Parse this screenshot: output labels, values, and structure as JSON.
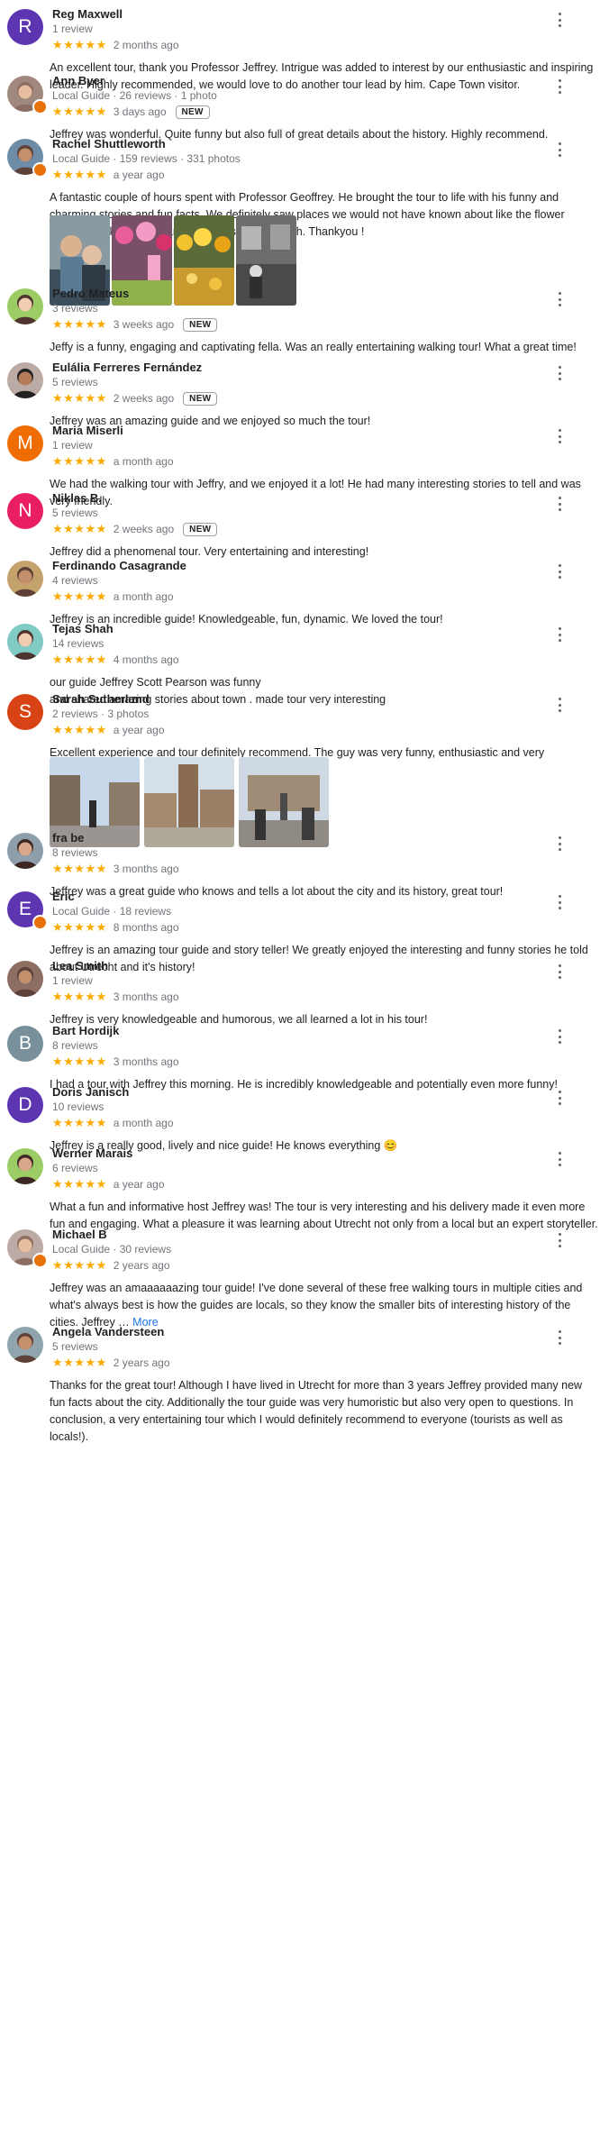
{
  "labels": {
    "new_badge": "NEW",
    "more_link": "More"
  },
  "stars_glyphs": "★★★★★",
  "colors": {
    "star": "#f9ab00",
    "new_border": "#9aa0a6",
    "local_guide_badge": "#e8710a",
    "more_link": "#1a73e8"
  },
  "reviews": [
    {
      "name": "Reg Maxwell",
      "meta": "1 review",
      "rating": 5,
      "date": "2 months ago",
      "text": "An excellent tour, thank you Professor Jeffrey. Intrigue was added to interest by our enthusiastic and inspiring leader. Highly recommended, we would love to do another tour lead by him.  Cape Town visitor.",
      "avatar_letter": "R",
      "avatar_color": "#5e35b1"
    },
    {
      "name": "Ann Byer",
      "meta": "Local Guide · 26 reviews · 1 photo",
      "rating": 5,
      "date": "3 days ago",
      "badge": "NEW",
      "text": "Jeffrey was wonderful. Quite funny but also full of great details about the history. Highly recommend.",
      "avatar_icon": "profile-photo-icon"
    },
    {
      "name": "Rachel Shuttleworth",
      "meta": "Local Guide · 159 reviews · 331 photos",
      "rating": 5,
      "date": "a year ago",
      "text": "A fantastic couple of hours spent with Professor Geoffrey.  He brought the tour to life with his funny and charming stories and fun facts. We definitely saw places we would not have known about like the flower market.  His knowledge and passion shone through. Thankyou !",
      "avatar_icon": "profile-photo-icon"
    },
    {
      "name": "Pedro Mateus",
      "meta": "3 reviews",
      "rating": 5,
      "date": "3 weeks ago",
      "badge": "NEW",
      "text": "Jeffy is a funny, engaging and captivating fella. Was an really entertaining walking tour! What a great time!",
      "avatar_icon": "profile-photo-icon"
    },
    {
      "name": "Eulália Ferreres Fernández",
      "meta": "5 reviews",
      "rating": 5,
      "date": "2 weeks ago",
      "badge": "NEW",
      "text": "Jeffrey was an amazing guide and we enjoyed so much the tour!",
      "avatar_icon": "profile-photo-icon"
    },
    {
      "name": "Maria Miserli",
      "meta": "1 review",
      "rating": 5,
      "date": "a month ago",
      "text": "We had the walking tour with Jeffry, and we enjoyed it a lot! He had many interesting stories to tell and was very friendly.",
      "avatar_letter": "M",
      "avatar_color": "#ef6c00"
    },
    {
      "name": "Niklas B.",
      "meta": "5 reviews",
      "rating": 5,
      "date": "2 weeks ago",
      "badge": "NEW",
      "text": "Jeffrey did a phenomenal tour. Very entertaining and interesting!",
      "avatar_letter": "N",
      "avatar_color": "#e91e63"
    },
    {
      "name": "Ferdinando Casagrande",
      "meta": "4 reviews",
      "rating": 5,
      "date": "a month ago",
      "text": "Jeffrey is an incredible guide! Knowledgeable, fun, dynamic. We loved the tour!",
      "avatar_icon": "profile-photo-icon"
    },
    {
      "name": "Tejas Shah",
      "meta": "14 reviews",
      "rating": 5,
      "date": "4 months ago",
      "text": "our guide Jeffrey Scott Pearson was funny\nand  shared amazing  stories about town . made tour very interesting",
      "avatar_icon": "profile-photo-icon"
    },
    {
      "name": "Sarah Sutherland",
      "meta": "2 reviews · 3 photos",
      "rating": 5,
      "date": "a year ago",
      "text": "Excellent experience and tour definitely recommend. The guy was very funny, enthusiastic and very knowledgable.",
      "avatar_letter": "S",
      "avatar_color": "#d84315"
    },
    {
      "name": "fra be",
      "meta": "8 reviews",
      "rating": 5,
      "date": "3 months ago",
      "text": "Jeffrey was a great guide who knows and tells a lot about the city and its history, great tour!",
      "avatar_icon": "profile-photo-icon"
    },
    {
      "name": "Eric",
      "meta": "Local Guide · 18 reviews",
      "rating": 5,
      "date": "8 months ago",
      "text": "Jeffrey is an amazing tour guide and story teller! We greatly enjoyed the interesting and funny stories he told about Utrecht and it's history!",
      "avatar_letter": "E",
      "avatar_color": "#5e35b1"
    },
    {
      "name": "Lea Smith",
      "meta": "1 review",
      "rating": 5,
      "date": "3 months ago",
      "text": "Jeffrey is very knowledgeable and humorous, we all learned a lot in his tour!",
      "avatar_icon": "profile-photo-icon"
    },
    {
      "name": "Bart Hordijk",
      "meta": "8 reviews",
      "rating": 5,
      "date": "3 months ago",
      "text": "I had a tour with Jeffrey this morning. He is incredibly knowledgeable and potentially even more funny!",
      "avatar_letter": "B",
      "avatar_color": "#78909c"
    },
    {
      "name": "Doris Janisch",
      "meta": "10 reviews",
      "rating": 5,
      "date": "a month ago",
      "text": "Jeffrey is a really good, lively and nice guide! He knows everything 😊",
      "avatar_letter": "D",
      "avatar_color": "#5e35b1"
    },
    {
      "name": "Werner Marais",
      "meta": "6 reviews",
      "rating": 5,
      "date": "a year ago",
      "text": "What a fun and informative host Jeffrey was! The tour is very interesting and his delivery made it even more fun and engaging. What a pleasure it was learning about Utrecht not only from a local but an expert storyteller.",
      "avatar_icon": "profile-photo-icon"
    },
    {
      "name": "Michael B",
      "meta": "Local Guide · 30 reviews",
      "rating": 5,
      "date": "2 years ago",
      "text": "Jeffrey was an amaaaaaazing tour guide! I've done several of these free walking tours in multiple cities and what's always best is how the guides are locals, so they know the smaller bits of interesting history of the cities. Jeffrey … ",
      "more": true,
      "avatar_icon": "profile-photo-icon"
    },
    {
      "name": "Angela Vandersteen",
      "meta": "5 reviews",
      "rating": 5,
      "date": "2 years ago",
      "text": "Thanks for the great tour! Although I have lived in Utrecht for more than 3 years Jeffrey provided many new fun facts about the city. Additionally the tour guide was very humoristic but also very open to questions. In conclusion, a very entertaining tour which I would definitely recommend to everyone (tourists as well as locals!).",
      "avatar_icon": "profile-photo-icon"
    }
  ]
}
